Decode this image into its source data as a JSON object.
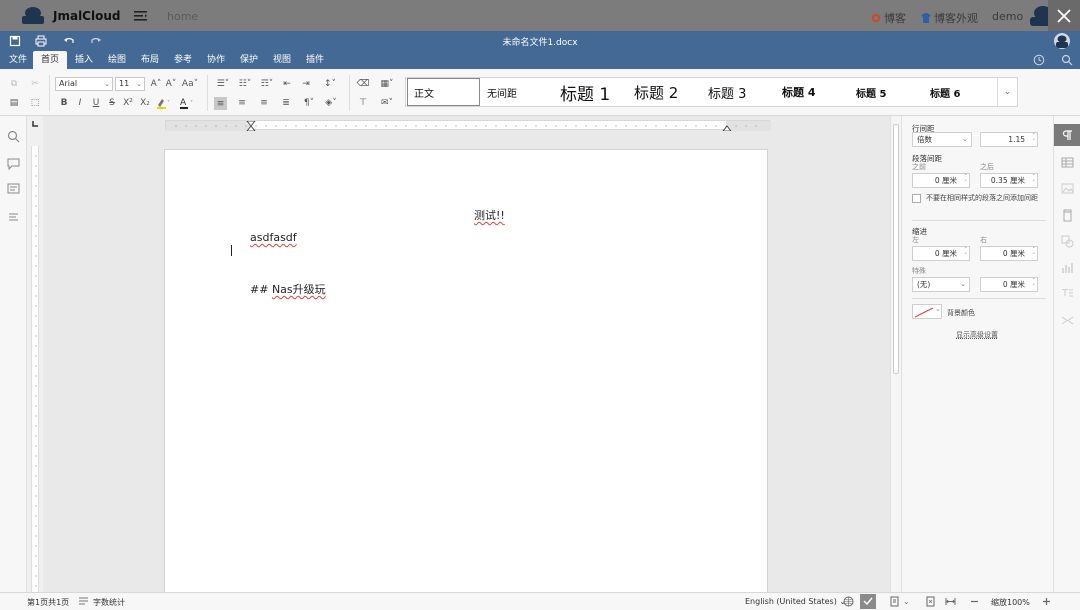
{
  "topbar": {
    "brand": "JmalCloud",
    "home": "home",
    "blog_link": "博客",
    "blog_theme_link": "博客外观",
    "user": "demo"
  },
  "titlebar": {
    "document_title": "未命名文件1.docx"
  },
  "tabs": [
    "文件",
    "首页",
    "插入",
    "绘图",
    "布局",
    "参考",
    "协作",
    "保护",
    "视图",
    "插件"
  ],
  "active_tab": "首页",
  "toolbar": {
    "font_name": "Arial",
    "font_size": "11",
    "styles": [
      "正文",
      "无间距",
      "标题 1",
      "标题 2",
      "标题 3",
      "标题 4",
      "标题 5",
      "标题 6"
    ]
  },
  "document": {
    "heading": "测试!!",
    "line1": "asdfasdf",
    "line3_prefix": "## ",
    "line3_text": "Nas升级玩"
  },
  "panel": {
    "line_spacing_title": "行间距",
    "line_spacing_mode": "倍数",
    "line_spacing_value": "1.15",
    "para_spacing_title": "段落间距",
    "before_label": "之前",
    "after_label": "之后",
    "before_value": "0 厘米",
    "after_value": "0.35 厘米",
    "no_space_same_style": "不要在相同样式的段落之间添加间距",
    "indent_title": "缩进",
    "left_label": "左",
    "right_label": "右",
    "left_value": "0 厘米",
    "right_value": "0 厘米",
    "special_label": "特殊",
    "special_mode": "(无)",
    "special_value": "0 厘米",
    "background_color_label": "背景颜色",
    "advanced_settings": "显示高级设置"
  },
  "statusbar": {
    "page_info": "第1页共1页",
    "word_count": "字数统计",
    "language": "English (United States)",
    "zoom": "缩放100%"
  },
  "colors": {
    "topbar_bg": "#7c7c7c",
    "titlebar_bg": "#446995",
    "spell_underline": "#e04040",
    "accent": "#446995"
  }
}
